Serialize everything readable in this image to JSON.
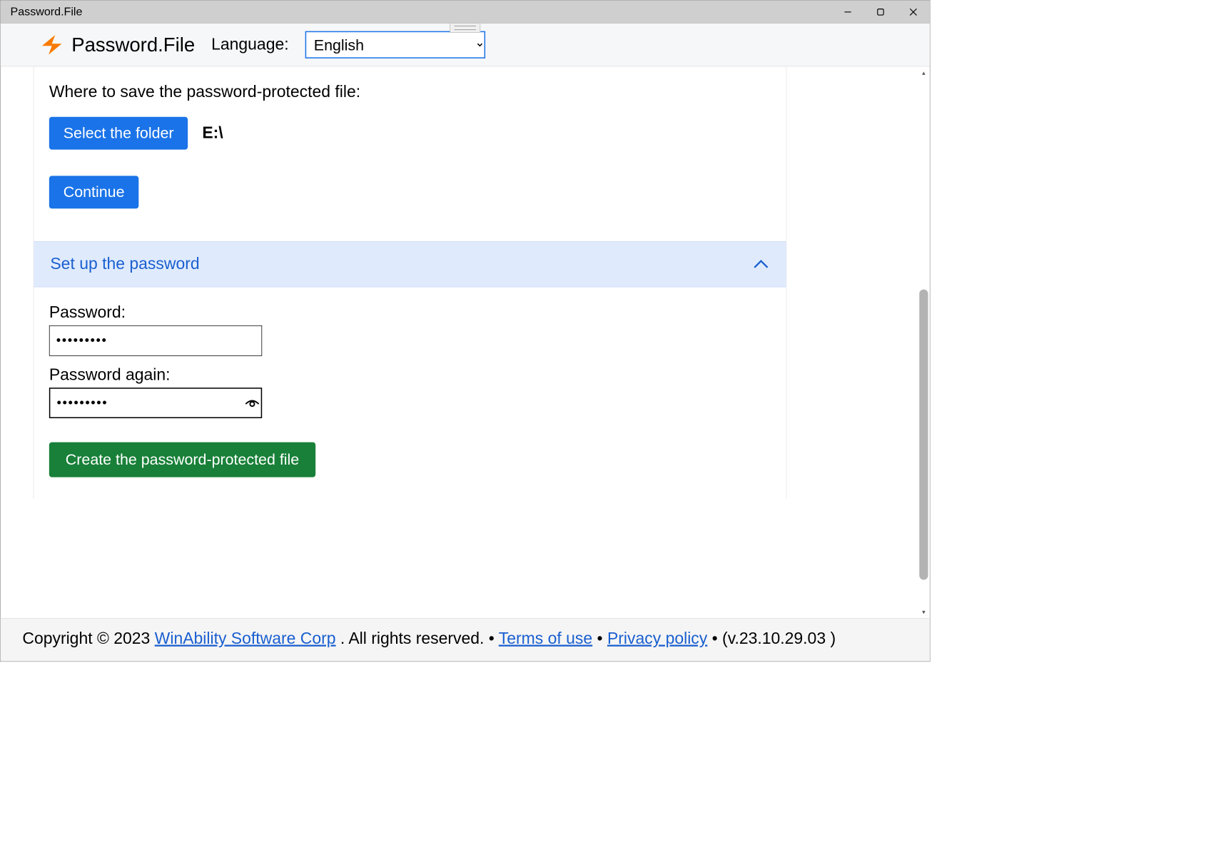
{
  "window": {
    "title": "Password.File"
  },
  "header": {
    "app_title": "Password.File",
    "language_label": "Language:",
    "language_value": "English"
  },
  "panel1": {
    "prompt": "Where to save the password-protected file:",
    "select_folder_label": "Select the folder",
    "path": "E:\\",
    "continue_label": "Continue"
  },
  "accordion": {
    "title": "Set up the password"
  },
  "panel2": {
    "password_label": "Password:",
    "password_value": "●●●●●●●●●",
    "password_again_label": "Password again:",
    "password_again_value": "●●●●●●●●●",
    "create_label": "Create the password-protected file"
  },
  "footer": {
    "copyright_prefix": "Copyright © 2023 ",
    "company": "WinAbility Software Corp",
    "rights": ". All rights reserved. ",
    "sep": " • ",
    "terms": "Terms of use",
    "privacy": "Privacy policy",
    "version": "• (v.23.10.29.03 )"
  }
}
